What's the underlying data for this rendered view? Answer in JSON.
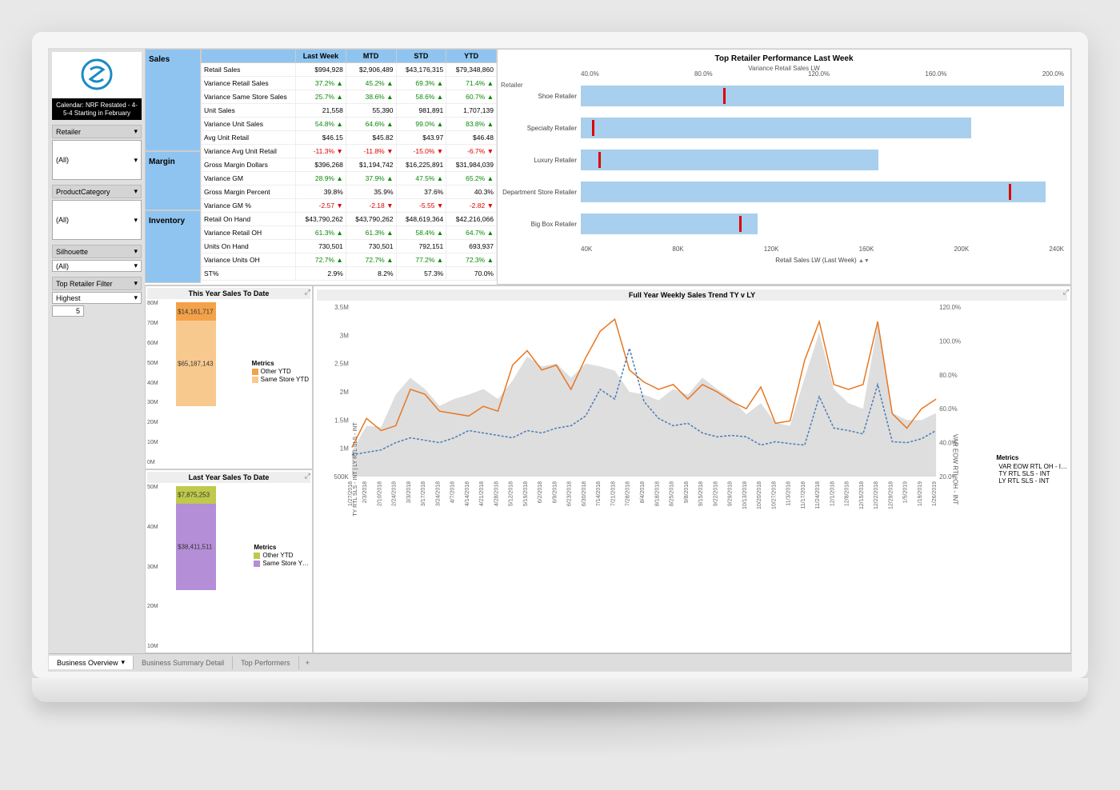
{
  "calendar_badge": "Calendar: NRF Restated - 4-5-4 Starting in February",
  "filters": {
    "retailer": {
      "label": "Retailer",
      "value": "(All)"
    },
    "product_category": {
      "label": "ProductCategory",
      "value": "(All)"
    },
    "silhouette": {
      "label": "Silhouette",
      "value": "(All)"
    },
    "top_retailer": {
      "label": "Top Retailer Filter",
      "dropdown": "Highest",
      "count": "5"
    }
  },
  "sections": {
    "sales": "Sales",
    "margin": "Margin",
    "inventory": "Inventory"
  },
  "table": {
    "headers": [
      "",
      "Last Week",
      "MTD",
      "STD",
      "YTD"
    ],
    "rows": [
      {
        "label": "Retail Sales",
        "vals": [
          "$994,928",
          "$2,906,489",
          "$43,176,315",
          "$79,348,860"
        ],
        "dir": [
          0,
          0,
          0,
          0
        ]
      },
      {
        "label": "Variance Retail Sales",
        "vals": [
          "37.2% ▲",
          "45.2% ▲",
          "69.3% ▲",
          "71.4% ▲"
        ],
        "dir": [
          1,
          1,
          1,
          1
        ]
      },
      {
        "label": "Variance Same Store Sales",
        "vals": [
          "25.7% ▲",
          "38.6% ▲",
          "58.6% ▲",
          "60.7% ▲"
        ],
        "dir": [
          1,
          1,
          1,
          1
        ]
      },
      {
        "label": "Unit Sales",
        "vals": [
          "21,558",
          "55,390",
          "981,891",
          "1,707,139"
        ],
        "dir": [
          0,
          0,
          0,
          0
        ]
      },
      {
        "label": "Variance Unit Sales",
        "vals": [
          "54.8% ▲",
          "64.6% ▲",
          "99.0% ▲",
          "83.8% ▲"
        ],
        "dir": [
          1,
          1,
          1,
          1
        ]
      },
      {
        "label": "Avg Unit Retail",
        "vals": [
          "$46.15",
          "$45.82",
          "$43.97",
          "$46.48"
        ],
        "dir": [
          0,
          0,
          0,
          0
        ]
      },
      {
        "label": "Variance Avg Unit Retail",
        "vals": [
          "-11.3% ▼",
          "-11.8% ▼",
          "-15.0% ▼",
          "-6.7% ▼"
        ],
        "dir": [
          -1,
          -1,
          -1,
          -1
        ]
      },
      {
        "label": "Gross Margin Dollars",
        "vals": [
          "$396,268",
          "$1,194,742",
          "$16,225,891",
          "$31,984,039"
        ],
        "dir": [
          0,
          0,
          0,
          0
        ]
      },
      {
        "label": "Variance GM",
        "vals": [
          "28.9% ▲",
          "37.9% ▲",
          "47.5% ▲",
          "65.2% ▲"
        ],
        "dir": [
          1,
          1,
          1,
          1
        ]
      },
      {
        "label": "Gross Margin Percent",
        "vals": [
          "39.8%",
          "35.9%",
          "37.6%",
          "40.3%"
        ],
        "dir": [
          0,
          0,
          0,
          0
        ]
      },
      {
        "label": "Variance GM %",
        "vals": [
          "-2.57 ▼",
          "-2.18 ▼",
          "-5.55 ▼",
          "-2.82 ▼"
        ],
        "dir": [
          -1,
          -1,
          -1,
          -1
        ]
      },
      {
        "label": "Retail On Hand",
        "vals": [
          "$43,790,262",
          "$43,790,262",
          "$48,619,364",
          "$42,216,066"
        ],
        "dir": [
          0,
          0,
          0,
          0
        ]
      },
      {
        "label": "Variance Retail OH",
        "vals": [
          "61.3% ▲",
          "61.3% ▲",
          "58.4% ▲",
          "64.7% ▲"
        ],
        "dir": [
          1,
          1,
          1,
          1
        ]
      },
      {
        "label": "Units On Hand",
        "vals": [
          "730,501",
          "730,501",
          "792,151",
          "693,937"
        ],
        "dir": [
          0,
          0,
          0,
          0
        ]
      },
      {
        "label": "Variance Units OH",
        "vals": [
          "72.7% ▲",
          "72.7% ▲",
          "77.2% ▲",
          "72.3% ▲"
        ],
        "dir": [
          1,
          1,
          1,
          1
        ]
      },
      {
        "label": "ST%",
        "vals": [
          "2.9%",
          "8.2%",
          "57.3%",
          "70.0%"
        ],
        "dir": [
          0,
          0,
          0,
          0
        ]
      }
    ]
  },
  "retailer_perf": {
    "title": "Top Retailer Performance Last Week",
    "subtitle": "Variance Retail Sales LW",
    "y_label": "Retailer",
    "x_bottom_label": "Retail Sales LW (Last Week)",
    "top_ticks": [
      "40.0%",
      "80.0%",
      "120.0%",
      "160.0%",
      "200.0%"
    ],
    "bottom_ticks": [
      "40K",
      "80K",
      "120K",
      "160K",
      "200K",
      "240K"
    ]
  },
  "ytd_this": {
    "title": "This Year Sales To Date",
    "legend_title": "Metrics",
    "seg1": "Other YTD",
    "seg2": "Same Store YTD",
    "val1": "$14,161,717",
    "val2": "$65,187,143",
    "ticks": [
      "80M",
      "70M",
      "60M",
      "50M",
      "40M",
      "30M",
      "20M",
      "10M",
      "0M"
    ]
  },
  "ytd_last": {
    "title": "Last Year Sales To Date",
    "legend_title": "Metrics",
    "seg1": "Other YTD",
    "seg2": "Same Store Y…",
    "val1": "$7,875,253",
    "val2": "$38,411,511",
    "ticks": [
      "50M",
      "40M",
      "30M",
      "20M",
      "10M"
    ]
  },
  "trend": {
    "title": "Full Year Weekly Sales Trend TY v LY",
    "legend_title": "Metrics",
    "series_names": [
      "VAR EOW RTL OH - I…",
      "TY RTL SLS - INT",
      "LY RTL SLS - INT"
    ],
    "y_left_label": "TY RTL SLS - INT  |  LY RTL SLS - INT",
    "y_right_label": "VAR EOW RTL OH - INT",
    "y_left_ticks": [
      "3.5M",
      "3M",
      "2.5M",
      "2M",
      "1.5M",
      "1M",
      "500K"
    ],
    "y_right_ticks": [
      "120.0%",
      "100.0%",
      "80.0%",
      "60.0%",
      "40.0%",
      "20.0%"
    ],
    "x_ticks": [
      "1/27/2018",
      "2/3/2018",
      "2/10/2018",
      "2/24/2018",
      "3/3/2018",
      "3/17/2018",
      "3/24/2018",
      "4/7/2018",
      "4/14/2018",
      "4/21/2018",
      "4/28/2018",
      "5/12/2018",
      "5/19/2018",
      "6/2/2018",
      "6/9/2018",
      "6/23/2018",
      "6/30/2018",
      "7/14/2018",
      "7/21/2018",
      "7/28/2018",
      "8/4/2018",
      "8/18/2018",
      "8/25/2018",
      "9/8/2018",
      "9/15/2018",
      "9/22/2018",
      "9/29/2018",
      "10/13/2018",
      "10/20/2018",
      "10/27/2018",
      "11/3/2018",
      "11/17/2018",
      "11/24/2018",
      "12/1/2018",
      "12/8/2018",
      "12/15/2018",
      "12/22/2018",
      "12/29/2018",
      "1/5/2019",
      "1/19/2019",
      "1/26/2019"
    ]
  },
  "tabs": {
    "active": "Business Overview",
    "t2": "Business Summary Detail",
    "t3": "Top Performers"
  },
  "chart_data": {
    "retailer_performance": {
      "type": "bar",
      "title": "Top Retailer Performance Last Week",
      "categories": [
        "Shoe Retailer",
        "Specialty Retailer",
        "Luxury Retailer",
        "Department Store Retailer",
        "Big Box Retailer"
      ],
      "series": [
        {
          "name": "Retail Sales LW (Last Week)",
          "values": [
            260000,
            210000,
            160000,
            250000,
            95000
          ],
          "axis": "bottom"
        },
        {
          "name": "Variance Retail Sales LW",
          "values": [
            65,
            5,
            8,
            195,
            72
          ],
          "axis": "top",
          "mark": "tick"
        }
      ],
      "x_bottom": {
        "label": "Retail Sales LW (Last Week)",
        "range": [
          0,
          260000
        ]
      },
      "x_top": {
        "label": "Variance Retail Sales LW (%)",
        "range": [
          0,
          220
        ]
      }
    },
    "this_year_sales": {
      "type": "stacked-bar",
      "title": "This Year Sales To Date",
      "segments": [
        {
          "name": "Other YTD",
          "value": 14161717,
          "color": "#f4a24a"
        },
        {
          "name": "Same Store YTD",
          "value": 65187143,
          "color": "#f8c98e"
        }
      ],
      "ylim": [
        0,
        80000000
      ]
    },
    "last_year_sales": {
      "type": "stacked-bar",
      "title": "Last Year Sales To Date",
      "segments": [
        {
          "name": "Other YTD",
          "value": 7875253,
          "color": "#bfc94a"
        },
        {
          "name": "Same Store YTD",
          "value": 38411511,
          "color": "#b48ed6"
        }
      ],
      "ylim": [
        0,
        50000000
      ]
    },
    "weekly_trend": {
      "type": "line",
      "title": "Full Year Weekly Sales Trend TY v LY",
      "x": [
        "1/27/2018",
        "2/3/2018",
        "2/10/2018",
        "2/24/2018",
        "3/3/2018",
        "3/17/2018",
        "3/24/2018",
        "4/7/2018",
        "4/14/2018",
        "4/21/2018",
        "4/28/2018",
        "5/12/2018",
        "5/19/2018",
        "6/2/2018",
        "6/9/2018",
        "6/23/2018",
        "6/30/2018",
        "7/14/2018",
        "7/21/2018",
        "7/28/2018",
        "8/4/2018",
        "8/18/2018",
        "8/25/2018",
        "9/8/2018",
        "9/15/2018",
        "9/22/2018",
        "9/29/2018",
        "10/13/2018",
        "10/20/2018",
        "10/27/2018",
        "11/3/2018",
        "11/17/2018",
        "11/24/2018",
        "12/1/2018",
        "12/8/2018",
        "12/15/2018",
        "12/22/2018",
        "12/29/2018",
        "1/5/2019",
        "1/19/2019",
        "1/26/2019"
      ],
      "series": [
        {
          "name": "TY RTL SLS - INT",
          "color": "#e87722",
          "axis": "left",
          "values": [
            600000,
            1200000,
            950000,
            1050000,
            1800000,
            1700000,
            1350000,
            1300000,
            1250000,
            1450000,
            1350000,
            2300000,
            2600000,
            2200000,
            2300000,
            1800000,
            2450000,
            3000000,
            3250000,
            2200000,
            1950000,
            1800000,
            1900000,
            1600000,
            1900000,
            1750000,
            1550000,
            1400000,
            1850000,
            1100000,
            1150000,
            2400000,
            3200000,
            1900000,
            1800000,
            1900000,
            3200000,
            1300000,
            1000000,
            1400000,
            1600000
          ]
        },
        {
          "name": "LY RTL SLS - INT",
          "color": "#4a7bb8",
          "axis": "left",
          "dash": true,
          "values": [
            450000,
            500000,
            550000,
            700000,
            800000,
            750000,
            700000,
            800000,
            950000,
            900000,
            850000,
            800000,
            950000,
            900000,
            1000000,
            1050000,
            1250000,
            1800000,
            1600000,
            2650000,
            1550000,
            1200000,
            1050000,
            1100000,
            900000,
            820000,
            850000,
            820000,
            650000,
            720000,
            680000,
            650000,
            1650000,
            1000000,
            950000,
            880000,
            1900000,
            720000,
            700000,
            780000,
            950000
          ]
        },
        {
          "name": "VAR EOW RTL OH - INT",
          "color": "#b8b8b8",
          "axis": "right",
          "type": "area",
          "values": [
            18,
            36,
            35,
            58,
            70,
            62,
            50,
            55,
            58,
            62,
            55,
            68,
            85,
            78,
            80,
            70,
            80,
            78,
            75,
            60,
            58,
            54,
            62,
            58,
            70,
            62,
            55,
            44,
            52,
            38,
            36,
            70,
            102,
            62,
            52,
            48,
            108,
            45,
            40,
            40,
            45
          ]
        }
      ],
      "y_left": {
        "label": "TY RTL SLS - INT | LY RTL SLS - INT",
        "range": [
          0,
          3500000
        ]
      },
      "y_right": {
        "label": "VAR EOW RTL OH - INT (%)",
        "range": [
          0,
          120
        ]
      }
    }
  }
}
